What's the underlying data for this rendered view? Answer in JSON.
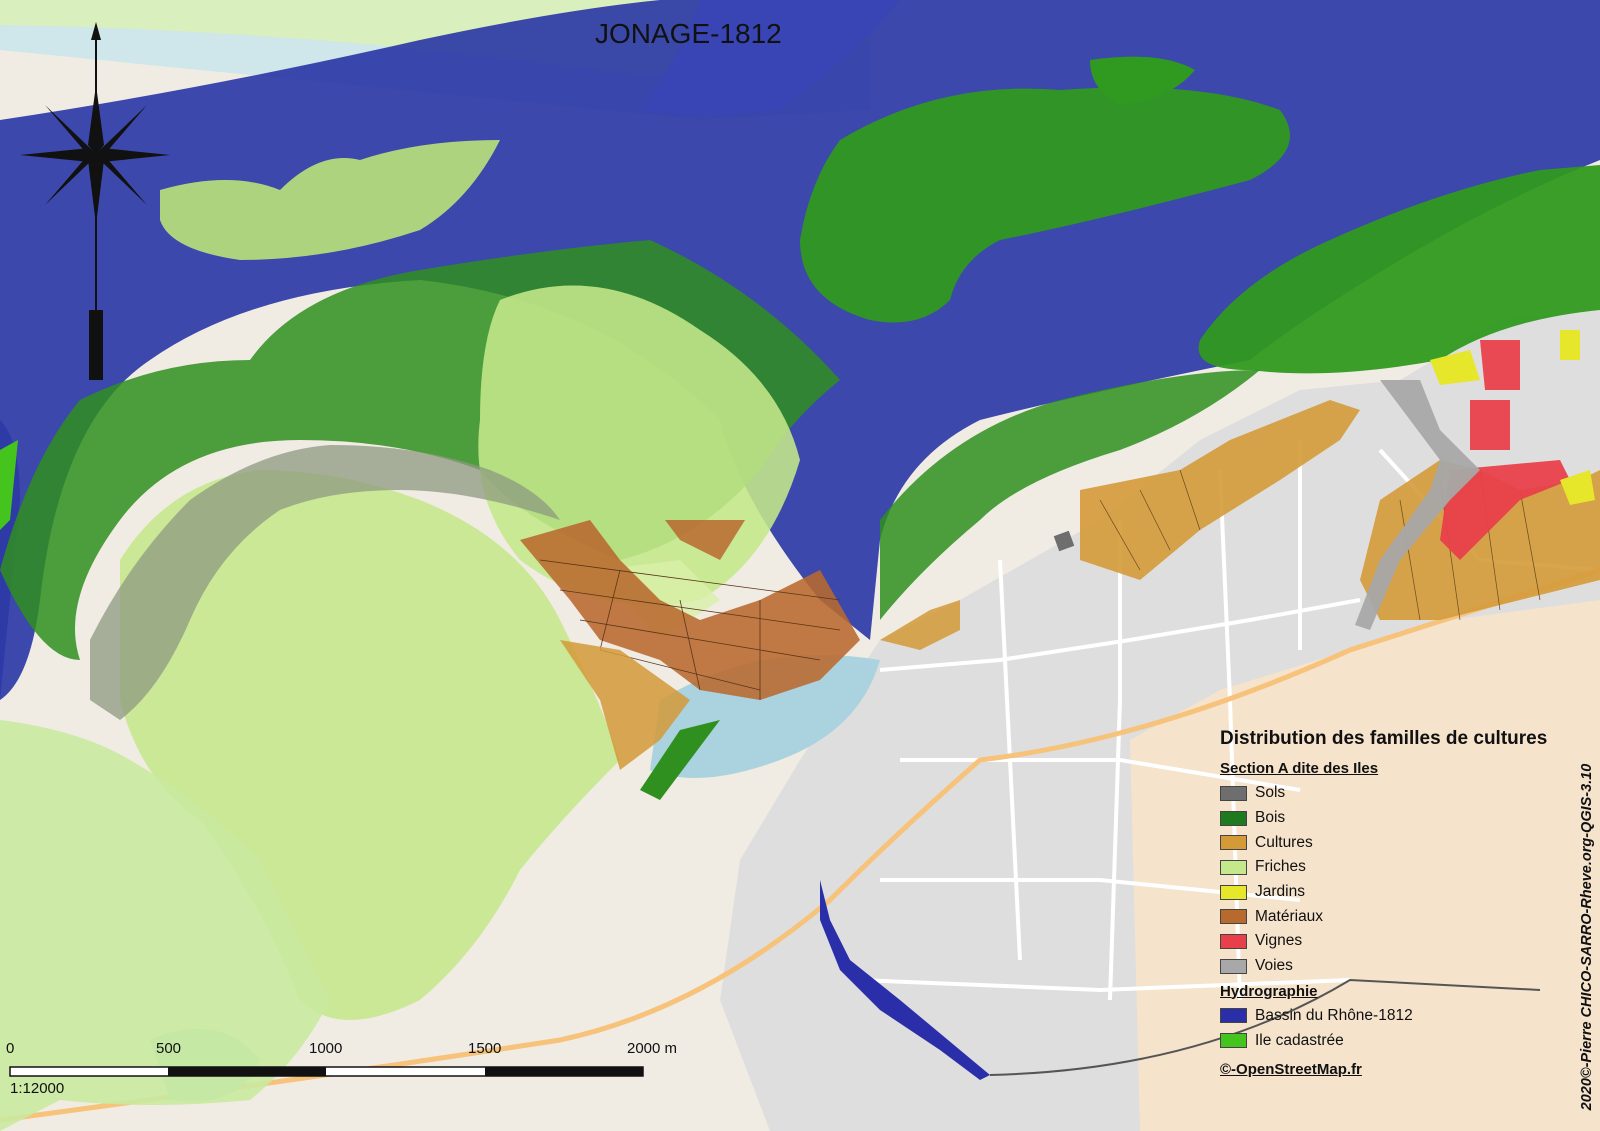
{
  "map": {
    "title": "JONAGE-1812",
    "scale_ticks": [
      "0",
      "500",
      "1000",
      "1500",
      "2000 m"
    ],
    "scale_ratio": "1:12000",
    "side_credit": "2020©-Pierre CHICO-SARRO-Rheve.org-QGIS-3.10"
  },
  "legend": {
    "title": "Distribution des familles de cultures",
    "section_label": "Section A dite des Iles",
    "items": [
      {
        "label": "Sols",
        "color": "#6e6e6e"
      },
      {
        "label": "Bois",
        "color": "#1f7a1f"
      },
      {
        "label": "Cultures",
        "color": "#d49a38"
      },
      {
        "label": "Friches",
        "color": "#c4e88a"
      },
      {
        "label": "Jardins",
        "color": "#e6e62a"
      },
      {
        "label": "Matériaux",
        "color": "#b8692e"
      },
      {
        "label": "Vignes",
        "color": "#e8404a"
      },
      {
        "label": "Voies",
        "color": "#a8a8a8"
      }
    ],
    "hydro_label": "Hydrographie",
    "hydro_items": [
      {
        "label": "Bassin du Rhône-1812",
        "color": "#2a2ea8"
      },
      {
        "label": "Ile cadastrée",
        "color": "#45c41e"
      }
    ],
    "osm_credit": "©-OpenStreetMap.fr"
  },
  "layers": {
    "river_color": "#2f3fa8",
    "wood_color": "#2f8f1f",
    "friche_color": "#b8e07a",
    "urban_color": "#dcdcdc"
  }
}
